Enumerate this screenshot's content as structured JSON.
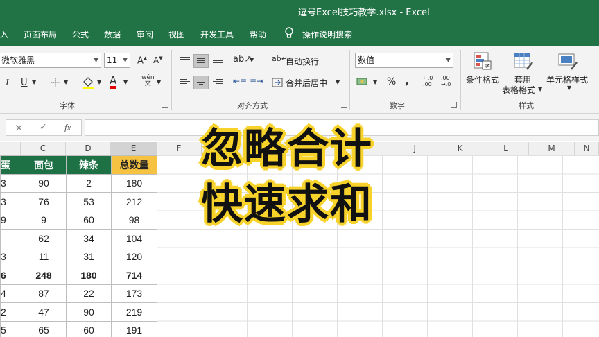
{
  "window": {
    "title": "逗号Excel技巧教学.xlsx  -  Excel"
  },
  "tabs": [
    "入",
    "页面布局",
    "公式",
    "数据",
    "审阅",
    "视图",
    "开发工具",
    "帮助"
  ],
  "tell_me": "操作说明搜索",
  "font_group": {
    "font_name": "微软雅黑",
    "font_size": "11",
    "grow": "A",
    "shrink": "A",
    "italic": "I",
    "underline": "U",
    "font_color_glyph": "A",
    "wen": "wén\n文",
    "label": "字体"
  },
  "alignment_group": {
    "wrap_text": "自动换行",
    "merge_center": "合并后居中",
    "label": "对齐方式"
  },
  "number_group": {
    "format": "数值",
    "percent": "%",
    "comma": ",",
    "inc_decimal": "←.0\n.00",
    "dec_decimal": ".00\n→.0",
    "label": "数字"
  },
  "styles_group": {
    "conditional": "条件格式",
    "table_line1": "套用",
    "table_line2": "表格格式",
    "cell_styles": "单元格样式",
    "label": "样式"
  },
  "formula_bar": {
    "cancel": "×",
    "enter": "✓",
    "fx": "fx"
  },
  "columns": [
    "C",
    "D",
    "E",
    "F",
    "G",
    "H",
    "I",
    "J",
    "K",
    "L",
    "M",
    "N"
  ],
  "table": {
    "headers": [
      "蛋",
      "面包",
      "辣条",
      "总数量"
    ],
    "rows": [
      [
        "3",
        "90",
        "2",
        "180"
      ],
      [
        "3",
        "76",
        "53",
        "212"
      ],
      [
        "9",
        "9",
        "60",
        "98"
      ],
      [
        "",
        "62",
        "34",
        "104"
      ],
      [
        "3",
        "11",
        "31",
        "120"
      ],
      [
        "6",
        "248",
        "180",
        "714"
      ],
      [
        "4",
        "87",
        "22",
        "173"
      ],
      [
        "2",
        "47",
        "90",
        "219"
      ],
      [
        "5",
        "65",
        "60",
        "191"
      ]
    ]
  },
  "overlay": {
    "line1": "忽略合计",
    "line2": "快速求和"
  },
  "colors": {
    "excel_green": "#217346",
    "header_green": "#1e7145",
    "total_header": "#f5c242",
    "caption_outline": "#f6d22b"
  }
}
